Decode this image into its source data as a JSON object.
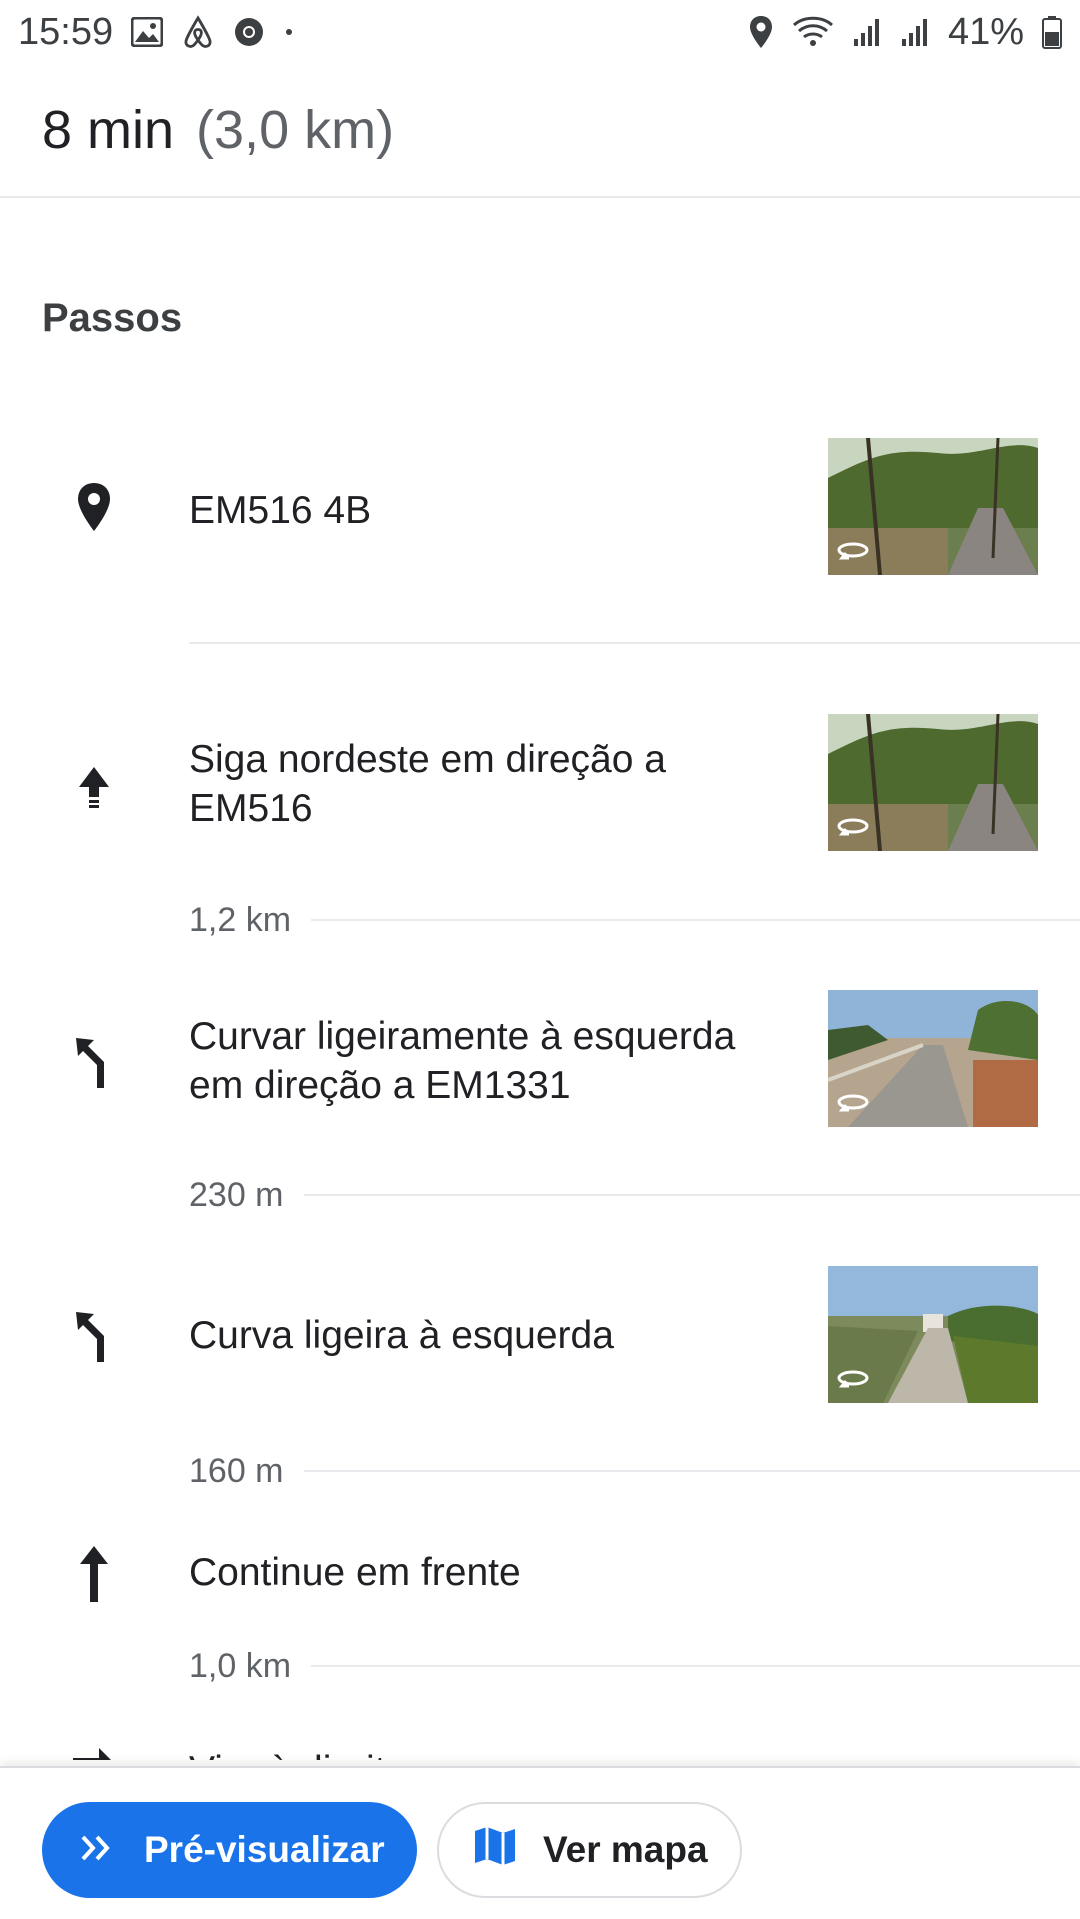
{
  "status_bar": {
    "time": "15:59",
    "battery_pct": "41%",
    "left_icons": [
      "image-icon",
      "airbnb-icon",
      "chrome-icon",
      "dot-icon"
    ],
    "right_icons": [
      "location-icon",
      "wifi-icon",
      "signal-icon",
      "signal-icon",
      "battery-icon"
    ]
  },
  "header": {
    "duration": "8 min",
    "distance": "(3,0 km)"
  },
  "steps_section": {
    "title": "Passos",
    "steps": [
      {
        "icon": "location-pin-icon",
        "text": "EM516 4B",
        "has_thumbnail": true
      },
      {
        "icon": "head-northeast-icon",
        "text": "Siga nordeste em direção a EM516",
        "distance": "1,2 km",
        "has_thumbnail": true
      },
      {
        "icon": "slight-left-icon",
        "text": "Curvar ligeiramente à esquerda em direção a EM1331",
        "distance": "230 m",
        "has_thumbnail": true
      },
      {
        "icon": "slight-left-icon",
        "text": "Curva ligeira à esquerda",
        "distance": "160 m",
        "has_thumbnail": true
      },
      {
        "icon": "straight-arrow-icon",
        "text": "Continue em frente",
        "distance": "1,0 km",
        "has_thumbnail": false
      },
      {
        "icon": "turn-right-icon",
        "text": "Vire à direita",
        "has_thumbnail": false
      }
    ]
  },
  "bottom_bar": {
    "preview_label": "Pré-visualizar",
    "map_label": "Ver mapa"
  },
  "colors": {
    "accent": "#1a73e8",
    "text_primary": "#202124",
    "text_secondary": "#5f6368",
    "divider": "#e8eaed"
  }
}
